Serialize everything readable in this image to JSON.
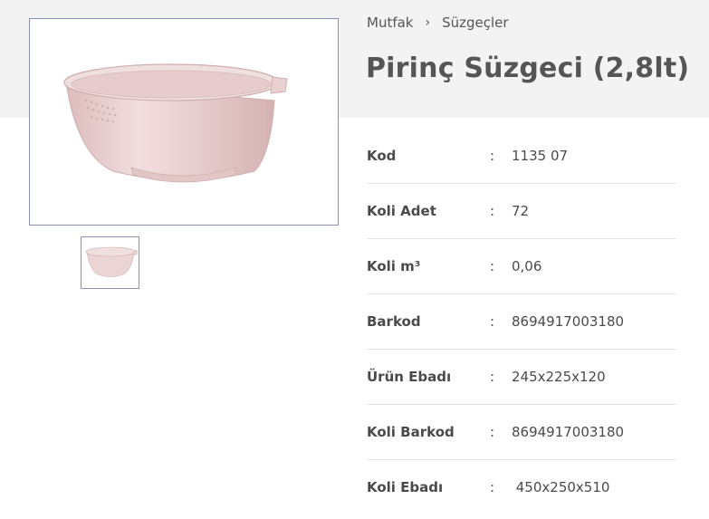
{
  "breadcrumb": {
    "items": [
      {
        "label": "Mutfak"
      },
      {
        "label": "Süzgeçler"
      }
    ],
    "separator": "›"
  },
  "product": {
    "title": "Pirinç Süzgeci (2,8lt)",
    "color": "#e9d1d1"
  },
  "specs": {
    "colon": ":",
    "rows": [
      {
        "label": "Kod",
        "value": "1135 07"
      },
      {
        "label": "Koli Adet",
        "value": "72"
      },
      {
        "label": "Koli m³",
        "value": "0,06"
      },
      {
        "label": "Barkod",
        "value": "8694917003180"
      },
      {
        "label": "Ürün Ebadı",
        "value": "245x225x120"
      },
      {
        "label": "Koli Barkod",
        "value": "8694917003180"
      },
      {
        "label": "Koli Ebadı",
        "value": " 450x250x510"
      }
    ]
  }
}
